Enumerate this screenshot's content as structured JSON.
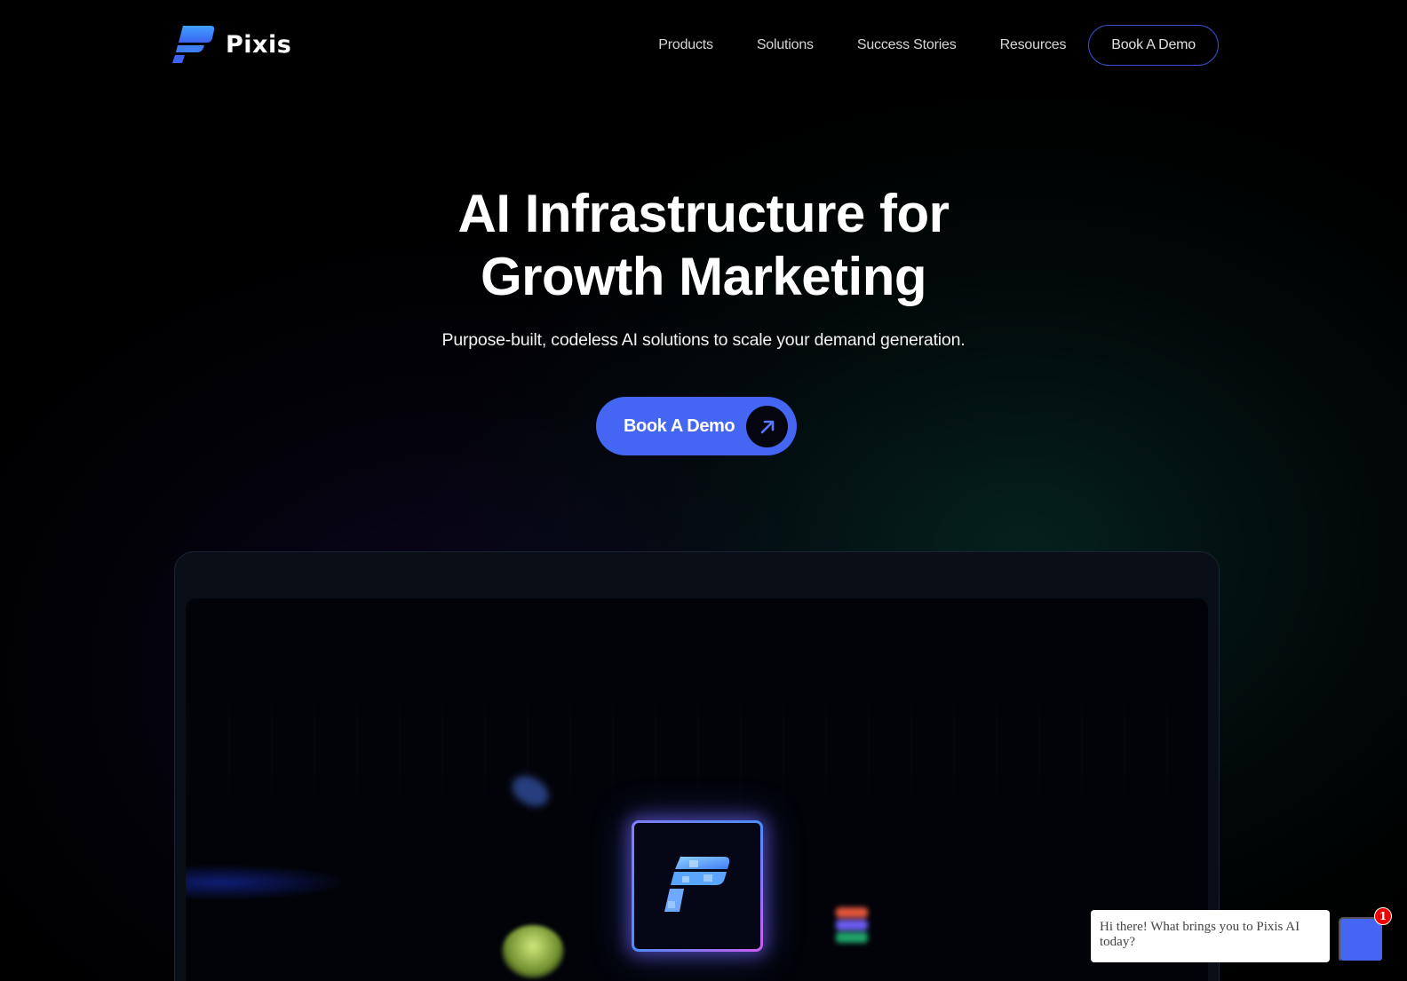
{
  "brand": {
    "name": "Pixis",
    "logo_icon": "pixis-p-logo-icon",
    "accent_color": "#4466f2"
  },
  "nav": {
    "items": [
      {
        "label": "Products"
      },
      {
        "label": "Solutions"
      },
      {
        "label": "Success Stories"
      },
      {
        "label": "Resources"
      }
    ],
    "cta_label": "Book A Demo"
  },
  "hero": {
    "title_line1": "AI Infrastructure for",
    "title_line2": "Growth Marketing",
    "subtitle": "Purpose-built, codeless AI solutions to scale your demand generation.",
    "cta_label": "Book A Demo",
    "cta_icon": "arrow-up-right-icon"
  },
  "showcase": {
    "tile_icon": "pixis-p-logo-icon",
    "floating_icons": [
      "blue-blob-icon",
      "green-orb-icon",
      "figma-icon"
    ]
  },
  "chat": {
    "message": "Hi there! What brings you to Pixis AI today?",
    "unread_count": "1"
  }
}
